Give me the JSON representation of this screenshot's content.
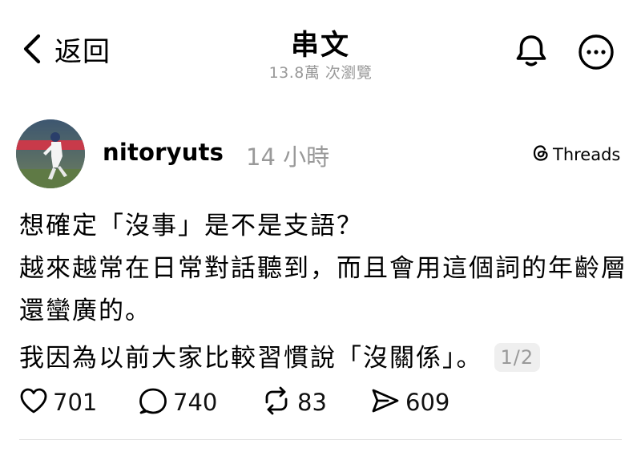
{
  "header": {
    "back_label": "返回",
    "title": "串文",
    "views": "13.8萬 次瀏覽"
  },
  "post": {
    "username": "nitoryuts",
    "time": "14 小時",
    "source_badge": "Threads",
    "paragraphs": [
      "想確定「沒事」是不是支語？",
      "越來越常在日常對話聽到，而且會用這個詞的年齡層還蠻廣的。",
      "我因為以前大家比較習慣說「沒關係」。"
    ],
    "page_indicator": "1/2"
  },
  "actions": {
    "likes": "701",
    "replies": "740",
    "reposts": "83",
    "shares": "609"
  },
  "icons": {
    "back": "chevron-left-icon",
    "bell": "bell-icon",
    "more": "more-horizontal-icon",
    "threads": "threads-logo-icon",
    "like": "heart-icon",
    "reply": "comment-icon",
    "repost": "repost-icon",
    "share": "share-icon"
  }
}
